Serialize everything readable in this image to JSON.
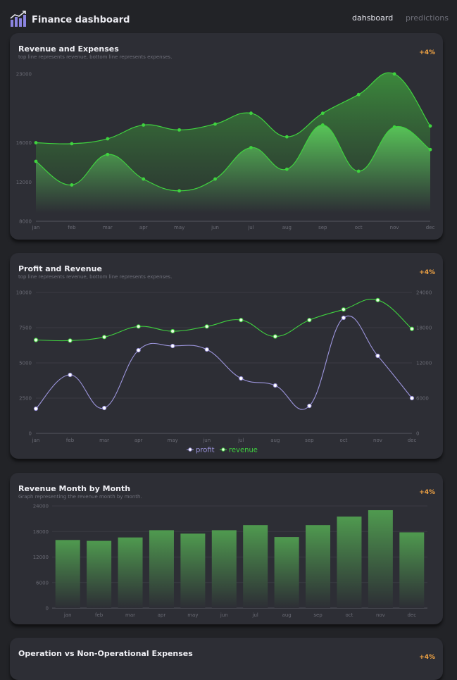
{
  "header": {
    "title": "Finance dashboard",
    "nav": [
      "dahsboard",
      "predictions"
    ],
    "logo_icon": "chart-growth-icon",
    "accent": "#8b84e0"
  },
  "colors": {
    "background": "#222327",
    "card": "#2d2e35",
    "green": "#3fd33f",
    "purple": "#9c95dc",
    "badge": "#f2a444"
  },
  "cards": [
    {
      "title": "Revenue and Expenses",
      "subtitle": "top line represents revenue, bottom line represents expenses.",
      "badge": "+4%"
    },
    {
      "title": "Profit and Revenue",
      "subtitle": "top line represents revenue, bottom line represents expenses.",
      "badge": "+4%"
    },
    {
      "title": "Revenue Month by Month",
      "subtitle": "Graph representing the revenue month by month.",
      "badge": "+4%"
    },
    {
      "title": "Operation vs Non-Operational Expenses",
      "subtitle": "",
      "badge": "+4%"
    }
  ],
  "chart_data": [
    {
      "type": "area",
      "categories": [
        "jan",
        "feb",
        "mar",
        "apr",
        "may",
        "jun",
        "jul",
        "aug",
        "sep",
        "oct",
        "nov",
        "dec"
      ],
      "series": [
        {
          "values": [
            16000,
            15900,
            16400,
            17800,
            17300,
            17900,
            19000,
            16600,
            19000,
            20900,
            23000,
            17700
          ]
        },
        {
          "values": [
            14100,
            11700,
            14800,
            12300,
            11100,
            12300,
            15500,
            13300,
            17800,
            13100,
            17600,
            15300
          ]
        }
      ],
      "yticks": [
        8000,
        12000,
        16000,
        23000
      ],
      "ylim": [
        8000,
        24000
      ]
    },
    {
      "type": "line",
      "categories": [
        "jan",
        "feb",
        "mar",
        "apr",
        "may",
        "jun",
        "jul",
        "aug",
        "sep",
        "oct",
        "nov",
        "dec"
      ],
      "series": [
        {
          "name": "profit",
          "axis": "left",
          "values": [
            1750,
            4150,
            1800,
            5900,
            6200,
            5950,
            3900,
            3400,
            1950,
            8200,
            5500,
            2500
          ]
        },
        {
          "name": "revenue",
          "axis": "right",
          "values": [
            15900,
            15800,
            16400,
            18200,
            17400,
            18200,
            19300,
            16500,
            19300,
            21100,
            22700,
            17800
          ]
        }
      ],
      "yticks_left": [
        0,
        2500,
        5000,
        7500,
        10000
      ],
      "yticks_right": [
        0,
        6000,
        12000,
        18000,
        24000
      ],
      "ylim_left": [
        0,
        10000
      ],
      "ylim_right": [
        0,
        24000
      ],
      "legend": "bottom"
    },
    {
      "type": "bar",
      "categories": [
        "jan",
        "feb",
        "mar",
        "apr",
        "may",
        "jun",
        "jul",
        "aug",
        "sep",
        "oct",
        "nov",
        "dec"
      ],
      "values": [
        16000,
        15800,
        16600,
        18300,
        17500,
        18300,
        19500,
        16700,
        19500,
        21500,
        23000,
        17800
      ],
      "yticks": [
        0,
        6000,
        12000,
        18000,
        24000
      ],
      "ylim": [
        0,
        24000
      ]
    }
  ]
}
